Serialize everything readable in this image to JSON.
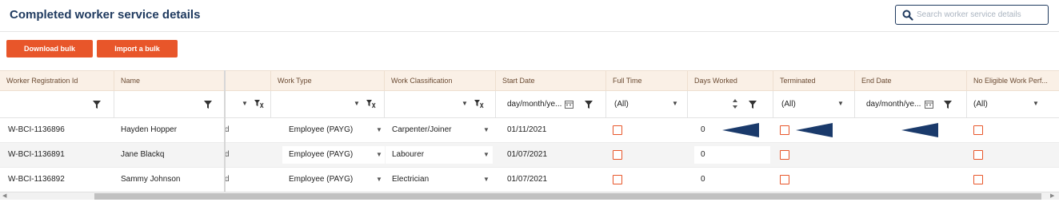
{
  "page": {
    "title": "Completed worker service details",
    "search_placeholder": "Search worker service details"
  },
  "toolbar": {
    "download_label": "Download bulk return",
    "import_label": "Import a bulk return"
  },
  "columns": [
    "Worker Registration Id",
    "Name",
    "",
    "Work Type",
    "Work Classification",
    "Start Date",
    "Full Time",
    "Days Worked",
    "Terminated",
    "End Date",
    "No Eligible Work Perf..."
  ],
  "filters": {
    "start_date_placeholder": "day/month/ye...",
    "end_date_placeholder": "day/month/ye...",
    "full_time": "(All)",
    "terminated": "(All)",
    "no_eligible": "(All)"
  },
  "rows": [
    {
      "id": "W-BCI-1136896",
      "name": "Hayden Hopper",
      "stub": "d",
      "work_type": "Employee (PAYG)",
      "classification": "Carpenter/Joiner",
      "start_date": "01/11/2021",
      "full_time": false,
      "days_worked": "0",
      "terminated": false,
      "end_date": "",
      "no_eligible": false
    },
    {
      "id": "W-BCI-1136891",
      "name": "Jane Blackq",
      "stub": "d",
      "work_type": "Employee (PAYG)",
      "classification": "Labourer",
      "start_date": "01/07/2021",
      "full_time": false,
      "days_worked": "0",
      "terminated": false,
      "end_date": "",
      "no_eligible": false
    },
    {
      "id": "W-BCI-1136892",
      "name": "Sammy Johnson",
      "stub": "d",
      "work_type": "Employee (PAYG)",
      "classification": "Electrician",
      "start_date": "01/07/2021",
      "full_time": false,
      "days_worked": "0",
      "terminated": false,
      "end_date": "",
      "no_eligible": false
    }
  ],
  "colors": {
    "accent": "#e8562a",
    "title": "#1f3a5f",
    "header_bg": "#faf0e6",
    "annotation_arrow": "#1a3a6b"
  },
  "icons": {
    "search": "search-icon",
    "filter": "filter-icon",
    "clear_filter": "clear-filter-icon",
    "calendar": "calendar-icon",
    "dropdown": "chevron-down-icon",
    "spinner": "spinner-icon",
    "annotation": "arrow-pointer-icon"
  }
}
